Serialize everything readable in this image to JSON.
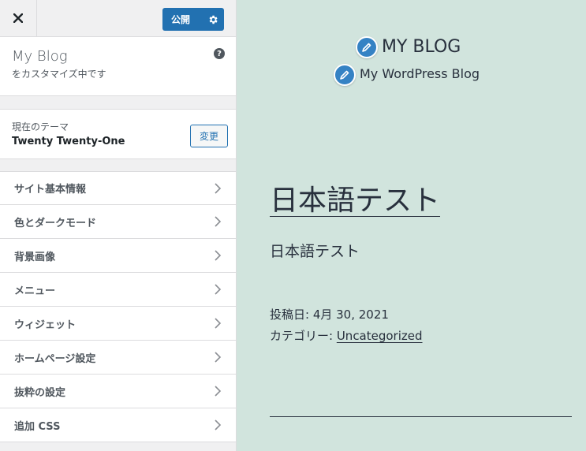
{
  "topbar": {
    "close_icon": "close-icon",
    "publish_label": "公開",
    "settings_icon": "gear-icon"
  },
  "site": {
    "name": "My Blog",
    "subtitle": "をカスタマイズ中です",
    "help_icon": "help-icon",
    "help_glyph": "?"
  },
  "theme": {
    "label": "現在のテーマ",
    "name": "Twenty Twenty-One",
    "change_label": "変更"
  },
  "menu": {
    "items": [
      {
        "label": "サイト基本情報"
      },
      {
        "label": "色とダークモード"
      },
      {
        "label": "背景画像"
      },
      {
        "label": "メニュー"
      },
      {
        "label": "ウィジェット"
      },
      {
        "label": "ホームページ設定"
      },
      {
        "label": "抜粋の設定"
      },
      {
        "label": "追加 CSS"
      }
    ]
  },
  "preview": {
    "background": "#d1e4dd",
    "accent": "#3582c4",
    "blog_title": "MY BLOG",
    "blog_tagline": "My WordPress Blog",
    "post_title": "日本語テスト",
    "post_body": "日本語テスト",
    "posted_label": "投稿日: ",
    "posted_date": "4月 30, 2021",
    "category_label": "カテゴリー: ",
    "category_value": "Uncategorized"
  }
}
